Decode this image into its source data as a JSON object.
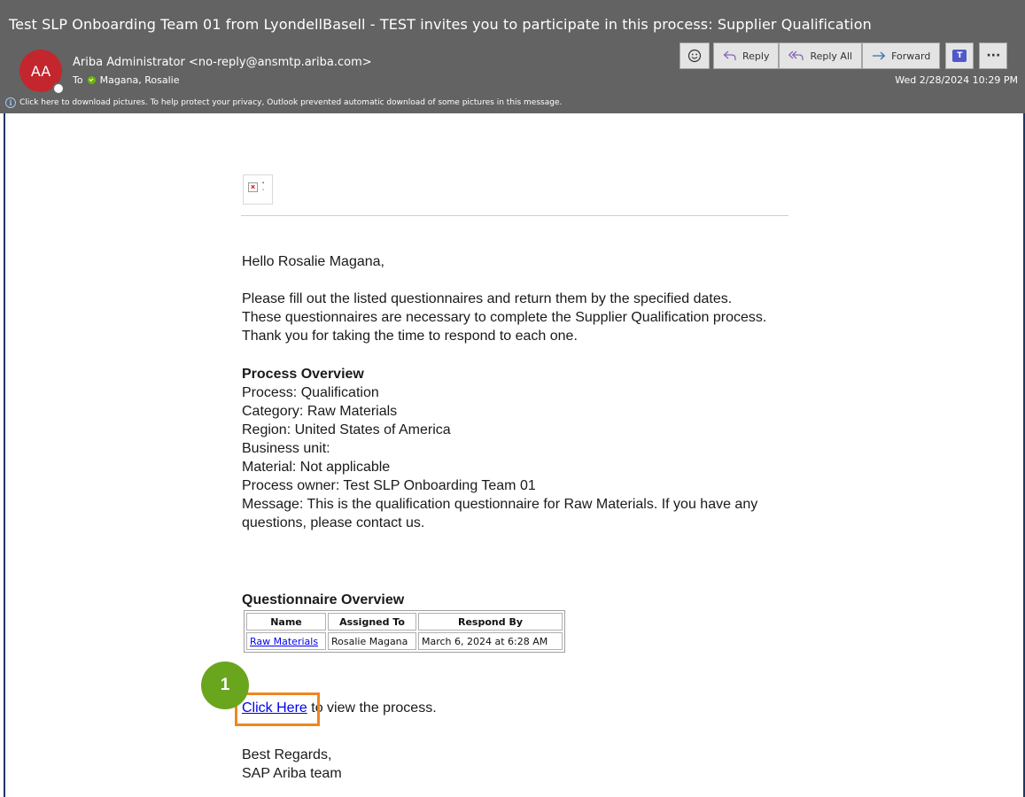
{
  "header": {
    "subject": "Test SLP Onboarding Team 01 from LyondellBasell - TEST invites you to participate in this process: Supplier Qualification",
    "avatar_initials": "AA",
    "sender": "Ariba Administrator <no-reply@ansmtp.ariba.com>",
    "to_label": "To",
    "to_name": "Magana, Rosalie",
    "info_text": "Click here to download pictures. To help protect your privacy, Outlook prevented automatic download of some pictures in this message.",
    "date": "Wed 2/28/2024 10:29 PM",
    "colors": {
      "background": "#636363",
      "avatar": "#c4262e",
      "presence": "#6bb700"
    }
  },
  "toolbar": {
    "reply_label": "Reply",
    "reply_all_label": "Reply All",
    "forward_label": "Forward",
    "more_label": "···",
    "icons": [
      "emoji-icon",
      "reply-icon",
      "reply-all-icon",
      "forward-icon",
      "teams-icon",
      "more-icon"
    ]
  },
  "email": {
    "broken_image_glyph": "×",
    "greeting": "Hello Rosalie Magana,",
    "para1": "Please fill out the listed questionnaires and return them by the specified dates.",
    "para2": "These questionnaires are necessary to complete the Supplier Qualification process. Thank you for taking the time to respond to each one.",
    "process_heading": "Process Overview",
    "process_lines": [
      "Process: Qualification",
      "Category: Raw Materials",
      "Region: United States of America",
      "Business unit:",
      "Material: Not applicable",
      "Process owner: Test SLP Onboarding Team 01",
      "Message: This is the qualification questionnaire for Raw Materials. If you have any questions, please contact us."
    ],
    "questionnaire_heading": "Questionnaire Overview",
    "table": {
      "headers": [
        "Name",
        "Assigned To",
        "Respond By"
      ],
      "rows": [
        [
          "Raw Materials",
          "Rosalie Magana",
          "March 6, 2024 at 6:28 AM"
        ]
      ]
    },
    "click_link": "Click Here",
    "click_rest": " to view the process.",
    "regards_1": "Best Regards,",
    "regards_2": "SAP Ariba team"
  },
  "annotation": {
    "callout_number": "1",
    "colors": {
      "callout": "#6aa51e",
      "highlight": "#f0861e"
    }
  }
}
